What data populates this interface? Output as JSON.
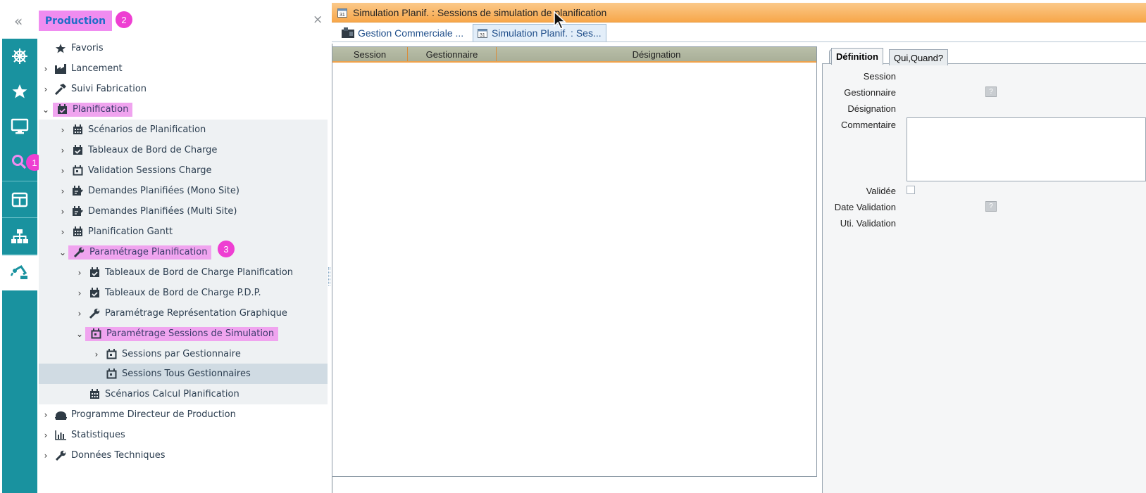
{
  "sidebar": {
    "collapse_label": "«",
    "module_title": "Production",
    "close_label": "×",
    "badges": {
      "module": "2",
      "search": "1",
      "param": "3"
    },
    "rail_icons": [
      "helm-icon",
      "star-icon",
      "monitor-icon",
      "search-icon",
      "layout-icon",
      "hierarchy-icon",
      "robot-arm-icon"
    ],
    "tree": [
      {
        "label": "Favoris",
        "icon": "star-icon",
        "chevron": "",
        "level": 0
      },
      {
        "label": "Lancement",
        "icon": "factory-icon",
        "chevron": "›",
        "level": 0
      },
      {
        "label": "Suivi Fabrication",
        "icon": "hammer-icon",
        "chevron": "›",
        "level": 0
      },
      {
        "label": "Planification",
        "icon": "calendar-check-icon",
        "chevron": "⌄",
        "level": 0
      },
      {
        "label": "Scénarios de Planification",
        "icon": "calendar-grid-icon",
        "chevron": "›",
        "level": 1
      },
      {
        "label": "Tableaux de Bord de Charge",
        "icon": "calendar-check-icon",
        "chevron": "›",
        "level": 1
      },
      {
        "label": "Validation Sessions Charge",
        "icon": "calendar-day-icon",
        "chevron": "›",
        "level": 1
      },
      {
        "label": "Demandes Planifiées (Mono Site)",
        "icon": "calendar-edit-icon",
        "chevron": "›",
        "level": 1
      },
      {
        "label": "Demandes Planifiées (Multi Site)",
        "icon": "calendar-edit-icon",
        "chevron": "›",
        "level": 1
      },
      {
        "label": "Planification Gantt",
        "icon": "calendar-grid-icon",
        "chevron": "›",
        "level": 1
      },
      {
        "label": "Paramétrage Planification",
        "icon": "wrench-icon",
        "chevron": "⌄",
        "level": 1
      },
      {
        "label": "Tableaux de Bord de Charge Planification",
        "icon": "calendar-check-icon",
        "chevron": "›",
        "level": 2
      },
      {
        "label": "Tableaux de Bord de Charge P.D.P.",
        "icon": "calendar-check-icon",
        "chevron": "›",
        "level": 2
      },
      {
        "label": "Paramétrage Représentation Graphique",
        "icon": "wrench-icon",
        "chevron": "›",
        "level": 2
      },
      {
        "label": "Paramétrage Sessions de Simulation",
        "icon": "calendar-day-icon",
        "chevron": "⌄",
        "level": 2
      },
      {
        "label": "Sessions par Gestionnaire",
        "icon": "calendar-day-icon",
        "chevron": "›",
        "level": 3
      },
      {
        "label": "Sessions Tous Gestionnaires",
        "icon": "calendar-day-icon",
        "chevron": "",
        "level": 3
      },
      {
        "label": "Scénarios Calcul Planification",
        "icon": "calendar-grid-icon",
        "chevron": "",
        "level": 2
      },
      {
        "label": "Programme Directeur de Production",
        "icon": "factory-roof-icon",
        "chevron": "›",
        "level": 0
      },
      {
        "label": "Statistiques",
        "icon": "bar-chart-icon",
        "chevron": "›",
        "level": 0
      },
      {
        "label": "Données Techniques",
        "icon": "wrench-icon",
        "chevron": "›",
        "level": 0
      }
    ]
  },
  "window": {
    "title": "Simulation Planif. : Sessions de simulation de planification",
    "tabs": [
      {
        "label": "Gestion Commerciale ...",
        "icon": "app-icon"
      },
      {
        "label": "Simulation Planif. : Ses...",
        "icon": "calendar-day-icon"
      }
    ]
  },
  "grid": {
    "columns": [
      "Session",
      "Gestionnaire",
      "Désignation"
    ]
  },
  "detail": {
    "tabs": [
      "Définition",
      "Qui,Quand?"
    ],
    "fields": {
      "session": "Session",
      "gestionnaire": "Gestionnaire",
      "designation": "Désignation",
      "commentaire": "Commentaire",
      "validee": "Validée",
      "date_validation": "Date Validation",
      "uti_validation": "Uti. Validation"
    },
    "lookup_label": "?"
  },
  "colors": {
    "rail": "#19929f",
    "highlight": "#f0a4ef",
    "badge": "#ee3fd2",
    "titlebar": "#f7a74a"
  }
}
